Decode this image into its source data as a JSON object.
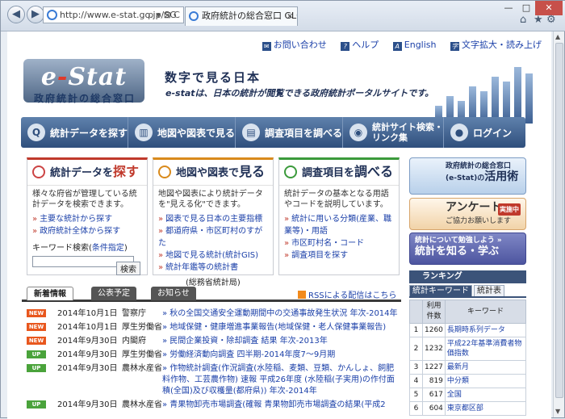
{
  "browser": {
    "address": "http://www.e-stat.go.jp/SG",
    "address_actions": "ρ ▾ ⊠ C",
    "tab_title": "政府統計の総合窓口 GL01...",
    "close_tab": "×",
    "window_controls": [
      "—",
      "□",
      "✕"
    ],
    "toolbar_icons": [
      "⌂",
      "★",
      "⚙"
    ]
  },
  "utility": {
    "contact": "お問い合わせ",
    "help": "ヘルプ",
    "english": "English",
    "text_size": "文字拡大・読み上げ"
  },
  "header": {
    "logo_text_e": "e",
    "logo_text_dash": "-",
    "logo_text_stat": "Stat",
    "logo_subtitle": "政府統計の総合窓口",
    "hero_title": "数字で見る日本",
    "hero_tagline": "e-statは、日本の統計が閲覧できる政府統計ポータルサイトです。"
  },
  "nav": [
    {
      "label": "統計データを探す",
      "icon": "Q"
    },
    {
      "label": "地図や図表で見る",
      "icon": "▥"
    },
    {
      "label": "調査項目を調べる",
      "icon": "▤"
    },
    {
      "label": "統計サイト検索・\nリンク集",
      "icon": "◉"
    },
    {
      "label": "ログイン",
      "icon": "●"
    }
  ],
  "panels": {
    "search": {
      "title_pre": "統計データを",
      "title_big": "探す",
      "desc": "様々な府省が管理している統計データを検索できます。",
      "links": [
        "主要な統計から探す",
        "政府統計全体から探す"
      ],
      "keyword_label": "キーワード検索(",
      "keyword_link": "条件指定",
      "keyword_close": ")",
      "search_btn": "検索"
    },
    "map": {
      "title_pre": "地図や図表で",
      "title_big": "見る",
      "desc": "地図や図表により統計データを\"見える化\"できます。",
      "links": [
        "図表で見る日本の主要指標",
        "都道府県・市区町村のすがた",
        "地図で見る統計(統計GIS)",
        "統計年鑑等の統計書"
      ],
      "note": "(総務省統計局)"
    },
    "survey": {
      "title_pre": "調査項目を",
      "title_big": "調べる",
      "desc": "統計データの基本となる用語やコードを説明しています。",
      "links": [
        "統計に用いる分類(産業、職業等)・用語",
        "市区町村名・コード",
        "調査項目を探す"
      ]
    }
  },
  "promos": {
    "p1_line1": "政府統計の総合窓口",
    "p1_line2a": "(e-Stat)の",
    "p1_line2b": "活用術",
    "p2_title": "アンケート",
    "p2_badge": "実施中",
    "p2_sub": "ご協力お願いします",
    "p3_line1": "統計について勉強しよう »",
    "p3_line2": "統計を知る・学ぶ"
  },
  "ranking": {
    "title": "ランキング",
    "tabs": [
      "統計キーワード",
      "統計表"
    ],
    "col_hits": "利用件数",
    "col_keyword": "キーワード",
    "rows": [
      {
        "rank": "1",
        "count": "1260",
        "keyword": "長期時系列データ"
      },
      {
        "rank": "2",
        "count": "1232",
        "keyword": "平成22年基準消費者物価指数"
      },
      {
        "rank": "3",
        "count": "1227",
        "keyword": "最新月"
      },
      {
        "rank": "4",
        "count": "819",
        "keyword": "中分類"
      },
      {
        "rank": "5",
        "count": "617",
        "keyword": "全国"
      },
      {
        "rank": "6",
        "count": "604",
        "keyword": "東京都区部"
      }
    ]
  },
  "news": {
    "tabs": [
      "新着情報",
      "公表予定",
      "お知らせ"
    ],
    "rss": "RSSによる配信はこちら",
    "items": [
      {
        "badge": "NEW",
        "date": "2014年10月1日",
        "org": "警察庁",
        "title": "秋の全国交通安全運動期間中の交通事故発生状況 年次-2014年"
      },
      {
        "badge": "NEW",
        "date": "2014年10月1日",
        "org": "厚生労働省",
        "title": "地域保健・健康増進事業報告(地域保健・老人保健事業報告)"
      },
      {
        "badge": "NEW",
        "date": "2014年9月30日",
        "org": "内閣府",
        "title": "民間企業投資・除却調査 結果 年次-2013年"
      },
      {
        "badge": "UP",
        "date": "2014年9月30日",
        "org": "厚生労働省",
        "title": "労働経済動向調査 四半期-2014年度7～9月期"
      },
      {
        "badge": "UP",
        "date": "2014年9月30日",
        "org": "農林水産省",
        "title": "作物統計調査(作況調査(水陸稲、麦類、豆類、かんしょ、飼肥料作物、工芸農作物) 速報 平成26年度 (水陸稲(子実用)の作付面積(全国)及び収穫量(都府県)) 年次-2014年"
      },
      {
        "badge": "UP",
        "date": "2014年9月30日",
        "org": "農林水産省",
        "title": "青果物卸売市場調査(確報 青果物卸売市場調査の結果(平成2"
      }
    ]
  }
}
